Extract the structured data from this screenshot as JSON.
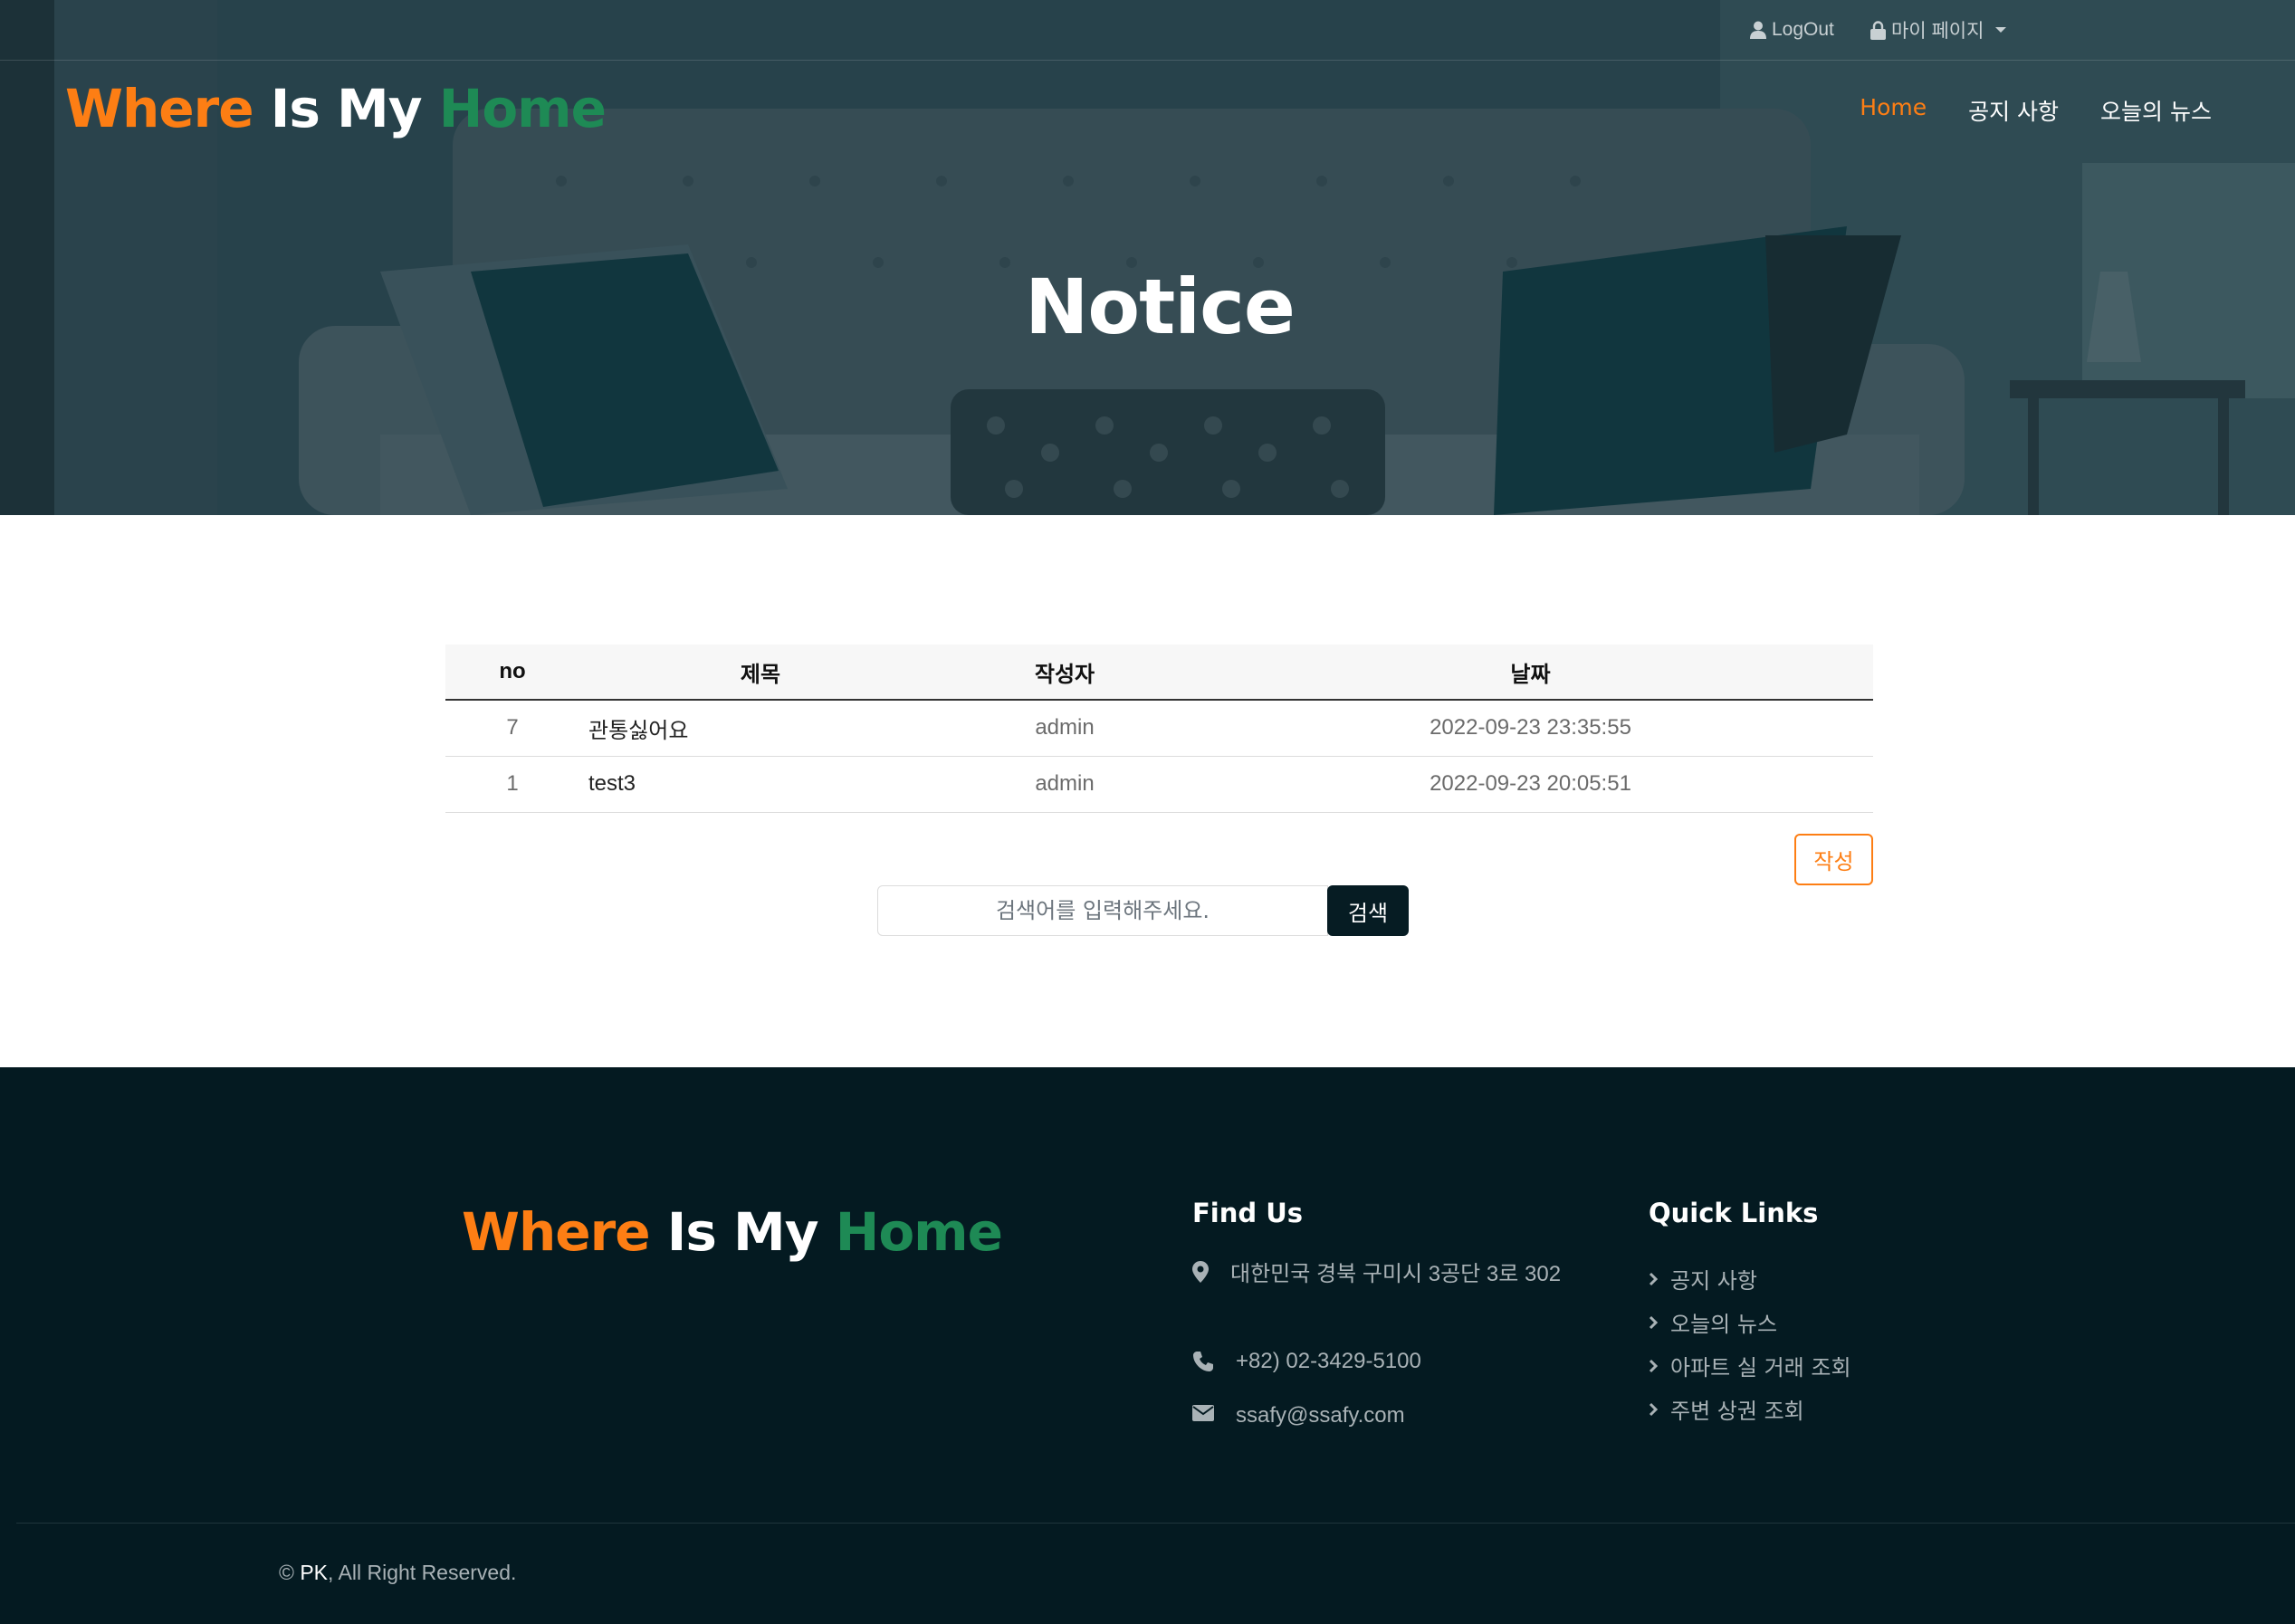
{
  "topbar": {
    "logout_label": "LogOut",
    "mypage_label": "마이 페이지"
  },
  "brand": {
    "part1": "Where",
    "part2": "Is My",
    "part3": "Home"
  },
  "nav": {
    "items": [
      {
        "label": "Home",
        "active": true
      },
      {
        "label": "공지 사항",
        "active": false
      },
      {
        "label": "오늘의 뉴스",
        "active": false
      }
    ]
  },
  "hero": {
    "title": "Notice"
  },
  "table": {
    "headers": [
      "no",
      "제목",
      "작성자",
      "날짜"
    ],
    "rows": [
      {
        "no": "7",
        "title": "관통싫어요",
        "writer": "admin",
        "date": "2022-09-23 23:35:55"
      },
      {
        "no": "1",
        "title": "test3",
        "writer": "admin",
        "date": "2022-09-23 20:05:51"
      }
    ]
  },
  "actions": {
    "write_label": "작성",
    "search_placeholder": "검색어를 입력해주세요.",
    "search_label": "검색"
  },
  "footer": {
    "find_us_title": "Find Us",
    "address": "대한민국 경북 구미시 3공단 3로 302",
    "phone": "+82) 02-3429-5100",
    "email": "ssafy@ssafy.com",
    "quick_links_title": "Quick Links",
    "quick_links": [
      "공지 사항",
      "오늘의 뉴스",
      "아파트 실 거래 조회",
      "주변 상권 조회"
    ],
    "copyright_owner": "PK",
    "copyright_text": ", All Right Reserved."
  },
  "colors": {
    "accent": "#fd7e14",
    "brand_green": "#1e8a55",
    "footer_bg": "#041a21"
  }
}
